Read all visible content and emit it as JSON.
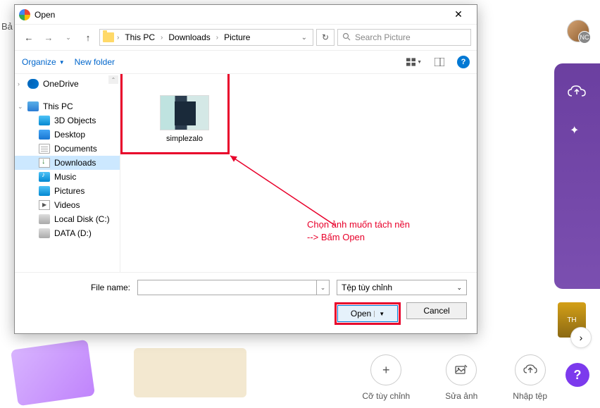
{
  "bg": {
    "top_text": "Bả",
    "avatar_badge": "NC",
    "actions": [
      {
        "icon": "+",
        "label": "Cỡ tùy chỉnh"
      },
      {
        "icon": "✦",
        "label": "Sửa ảnh"
      },
      {
        "icon": "⤓",
        "label": "Nhập tệp"
      }
    ],
    "thumb3_text": "TH"
  },
  "dialog": {
    "title": "Open",
    "path": [
      "This PC",
      "Downloads",
      "Picture"
    ],
    "search_placeholder": "Search Picture",
    "toolbar": {
      "organize": "Organize",
      "newfolder": "New folder"
    },
    "sidebar": [
      {
        "label": "OneDrive",
        "icon": "onedrive",
        "chevron": "›"
      },
      {
        "label": "This PC",
        "icon": "pc",
        "chevron": "⌄",
        "top_gap": true
      },
      {
        "label": "3D Objects",
        "icon": "3d",
        "sub": true
      },
      {
        "label": "Desktop",
        "icon": "desktop",
        "sub": true
      },
      {
        "label": "Documents",
        "icon": "docs",
        "sub": true
      },
      {
        "label": "Downloads",
        "icon": "downloads",
        "sub": true,
        "selected": true
      },
      {
        "label": "Music",
        "icon": "music",
        "sub": true
      },
      {
        "label": "Pictures",
        "icon": "pics",
        "sub": true
      },
      {
        "label": "Videos",
        "icon": "videos",
        "sub": true
      },
      {
        "label": "Local Disk (C:)",
        "icon": "disk",
        "sub": true
      },
      {
        "label": "DATA (D:)",
        "icon": "disk",
        "sub": true
      }
    ],
    "file_item": "simplezalo",
    "annotation": "Chọn ảnh muốn tách nền\n--> Bấm Open",
    "footer": {
      "filename_label": "File name:",
      "filename_value": "",
      "filetype": "Tệp tùy chỉnh",
      "open": "Open",
      "cancel": "Cancel"
    }
  }
}
